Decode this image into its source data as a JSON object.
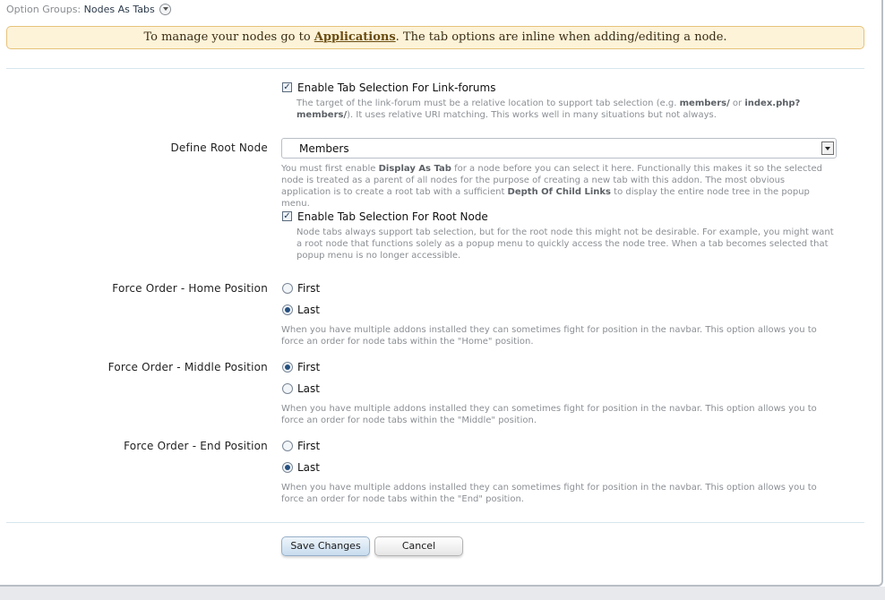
{
  "header": {
    "option_groups_label": "Option Groups:",
    "option_groups_value": "Nodes As Tabs"
  },
  "notice": {
    "prefix": "To manage your nodes go to ",
    "link": "Applications",
    "suffix": ". The tab options are inline when adding/editing a node."
  },
  "link_forums": {
    "checked": true,
    "label": "Enable Tab Selection For Link-forums",
    "explain_1": "The target of the link-forum must be a relative location to support tab selection (e.g. ",
    "explain_b1": "members/",
    "explain_2": " or ",
    "explain_b2": "index.php?",
    "explain_b3": "members/",
    "explain_3": "). It uses relative URI matching. This works well in many situations but not always."
  },
  "root_node": {
    "label": "Define Root Node",
    "selected": "Members",
    "explain_1": "You must first enable ",
    "explain_b1": "Display As Tab",
    "explain_2": " for a node before you can select it here. Functionally this makes it so the selected node is treated as a parent of all nodes for the purpose of creating a new tab with this addon. The most obvious application is to create a root tab with a sufficient ",
    "explain_b2": "Depth Of Child Links",
    "explain_3": " to display the entire node tree in the popup menu."
  },
  "root_tab": {
    "checked": true,
    "label": "Enable Tab Selection For Root Node",
    "explain": "Node tabs always support tab selection, but for the root node this might not be desirable. For example, you might want a root node that functions solely as a popup menu to quickly access the node tree. When a tab becomes selected that popup menu is no longer accessible."
  },
  "force_home": {
    "label": "Force Order - Home Position",
    "options": [
      "First",
      "Last"
    ],
    "selected": "Last",
    "explain": "When you have multiple addons installed they can sometimes fight for position in the navbar. This option allows you to force an order for node tabs within the \"Home\" position."
  },
  "force_middle": {
    "label": "Force Order - Middle Position",
    "options": [
      "First",
      "Last"
    ],
    "selected": "First",
    "explain": "When you have multiple addons installed they can sometimes fight for position in the navbar. This option allows you to force an order for node tabs within the \"Middle\" position."
  },
  "force_end": {
    "label": "Force Order - End Position",
    "options": [
      "First",
      "Last"
    ],
    "selected": "Last",
    "explain": "When you have multiple addons installed they can sometimes fight for position in the navbar. This option allows you to force an order for node tabs within the \"End\" position."
  },
  "buttons": {
    "save": "Save Changes",
    "cancel": "Cancel"
  }
}
